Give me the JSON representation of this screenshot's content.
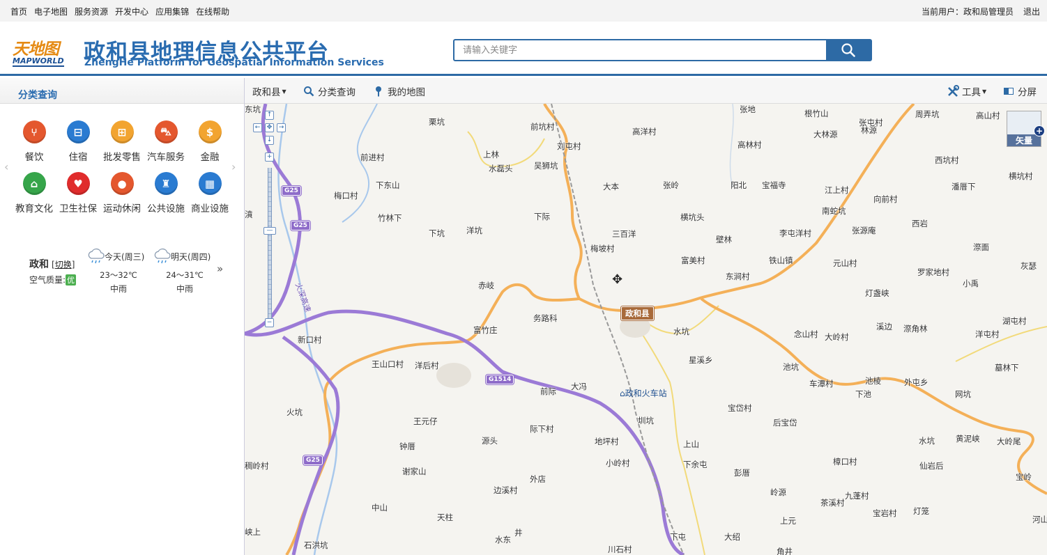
{
  "topnav": [
    "首页",
    "电子地图",
    "服务资源",
    "开发中心",
    "应用集锦",
    "在线帮助"
  ],
  "user": {
    "label": "当前用户：",
    "name": "政和局管理员",
    "logout": "退出"
  },
  "logo": {
    "cn": "天地图",
    "en": "MAPWORLD"
  },
  "header": {
    "title": "政和县地理信息公共平台",
    "subtitle": "ZhengHe Platform for Geospatial Information Services"
  },
  "search": {
    "placeholder": "请输入关键字",
    "icon": "search-icon"
  },
  "left_panel": {
    "title": "分类查询",
    "categories": [
      {
        "label": "餐饮",
        "icon": "fork-knife-icon",
        "color": "#e4572e"
      },
      {
        "label": "住宿",
        "icon": "bed-icon",
        "color": "#2a7bd1"
      },
      {
        "label": "批发零售",
        "icon": "shopping-cart-icon",
        "color": "#f2a430"
      },
      {
        "label": "汽车服务",
        "icon": "car-icon",
        "color": "#e4572e"
      },
      {
        "label": "金融",
        "icon": "money-bag-icon",
        "color": "#f2a430"
      },
      {
        "label": "教育文化",
        "icon": "school-icon",
        "color": "#36a54a"
      },
      {
        "label": "卫生社保",
        "icon": "health-icon",
        "color": "#e02c2c"
      },
      {
        "label": "运动休闲",
        "icon": "sport-icon",
        "color": "#e4572e"
      },
      {
        "label": "公共设施",
        "icon": "facility-icon",
        "color": "#2a7bd1"
      },
      {
        "label": "商业设施",
        "icon": "building-icon",
        "color": "#2a7bd1"
      }
    ]
  },
  "weather": {
    "city": "政和",
    "switch": "切换",
    "air_label": "空气质量:",
    "air_value": "优",
    "today": {
      "day": "今天(周三)",
      "temp": "23～32℃",
      "desc": "中雨"
    },
    "tomorrow": {
      "day": "明天(周四)",
      "temp": "24～31℃",
      "desc": "中雨"
    },
    "more": "»"
  },
  "toolbar": {
    "region": "政和县",
    "category": "分类查询",
    "mymap": "我的地图",
    "tools": "工具",
    "split": "分屏"
  },
  "map": {
    "type_label": "矢量",
    "county": "政和县",
    "station": "政和火车站",
    "shields": [
      "G25",
      "G25",
      "G25",
      "G1514",
      "火深高速"
    ],
    "places": [
      "张地",
      "根竹山",
      "周弄坑",
      "高山村",
      "栗坑",
      "前坑村",
      "高洋村",
      "大林源",
      "林源",
      "张屯村",
      "刘屯村",
      "高林村",
      "西坑村",
      "横坑村",
      "上林",
      "前进村",
      "水磊头",
      "吴狮坑",
      "潘厝下",
      "江上村",
      "向前村",
      "下东山",
      "大本",
      "张岭",
      "阳北",
      "宝福寺",
      "梅口村",
      "南蛇坑",
      "西岩",
      "竹林下",
      "下际",
      "横坑头",
      "张源庵",
      "下坑",
      "洋坑",
      "三百洋",
      "李屯洋村",
      "漈面",
      "梅坡村",
      "壁林",
      "濆",
      "富美村",
      "铁山镇",
      "元山村",
      "灰瑟",
      "罗家地村",
      "赤岐",
      "东涧村",
      "小禹",
      "灯盏峡",
      "务路科",
      "水坑",
      "溪边",
      "富竹庄",
      "念山村",
      "湖屯村",
      "大岭村",
      "漈角林",
      "洋屯村",
      "新口村",
      "星溪乡",
      "池坑",
      "王山口村",
      "洋后村",
      "车潭村",
      "池棱",
      "外屯乡",
      "墓林下",
      "大冯",
      "前际",
      "下池",
      "网坑",
      "火坑",
      "宝岱村",
      "后宝岱",
      "王元仔",
      "圳坑",
      "际下村",
      "源头",
      "地坪村",
      "钟厝",
      "上山",
      "水坑",
      "黄泥峡",
      "大岭尾",
      "稠岭村",
      "小岭村",
      "下余屯",
      "樟口村",
      "仙岩后",
      "谢家山",
      "彭厝",
      "宝岭",
      "外店",
      "边溪村",
      "岭源",
      "九蓬村",
      "茶溪村",
      "中山",
      "灯笼",
      "宝岩村",
      "天柱",
      "上元",
      "河山仔",
      "狸洋村",
      "峡上",
      "井",
      "水东",
      "下屯",
      "大绍",
      "石洪坑",
      "川石村",
      "角井",
      "东坑"
    ]
  }
}
